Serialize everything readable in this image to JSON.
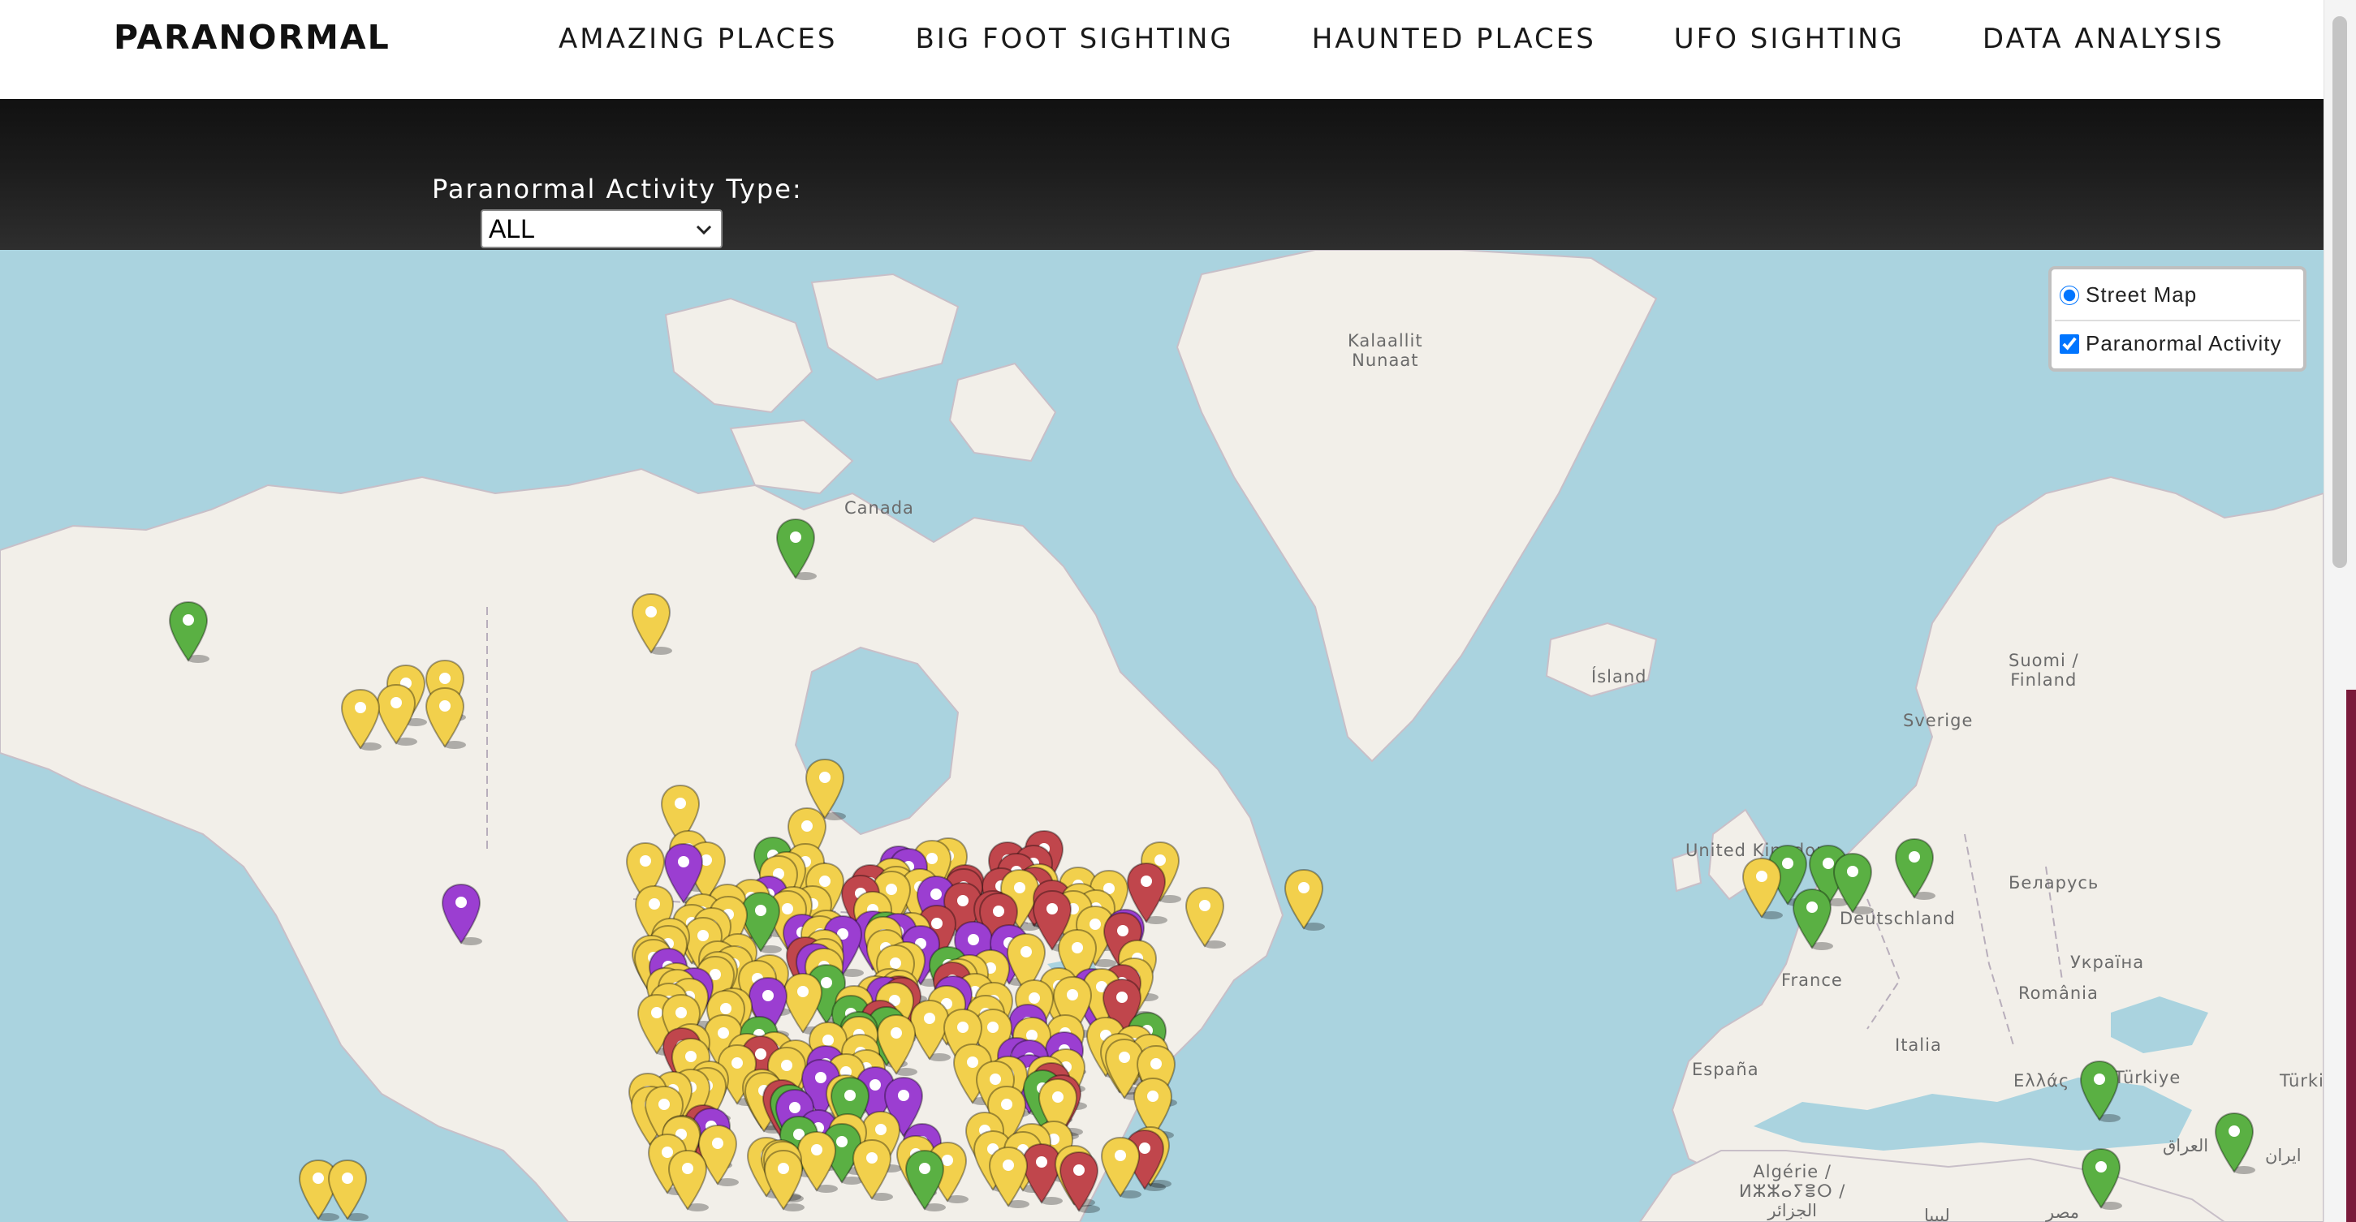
{
  "nav": {
    "brand": "PARANORMAL",
    "links": [
      "AMAZING PLACES",
      "BIG FOOT SIGHTING",
      "HAUNTED PLACES",
      "UFO SIGHTING",
      "DATA ANALYSIS"
    ]
  },
  "filter": {
    "label": "Paranormal Activity Type:",
    "selected": "ALL"
  },
  "layers": {
    "base": {
      "label": "Street Map",
      "selected": true
    },
    "overlay": {
      "label": "Paranormal Activity",
      "checked": true
    }
  },
  "map_labels": {
    "greenland": "Kalaallit\nNunaat",
    "canada": "Canada",
    "iceland": "Ísland",
    "finland": "Suomi /\nFinland",
    "sweden": "Sverige",
    "uk": "United Kingdom",
    "germany": "Deutschland",
    "belarus": "Беларусь",
    "ukraine": "Україна",
    "france": "France",
    "romania": "România",
    "italy": "Italia",
    "spain": "España",
    "greece": "Ελλάς",
    "turkiye": "Türkiye",
    "turkiye2": "Türki",
    "iraq": "العراق",
    "iran": "ایران",
    "algeria": "Algérie /\nⵍⵣⵣⴰⵢⴻⵔ /\nالجزائر",
    "egypt": "مصر",
    "libya": "ليبيا"
  },
  "marker_colors": {
    "yellow": "#f2d04c",
    "green": "#5ab043",
    "purple": "#9b3ed1",
    "red": "#c0464c"
  }
}
